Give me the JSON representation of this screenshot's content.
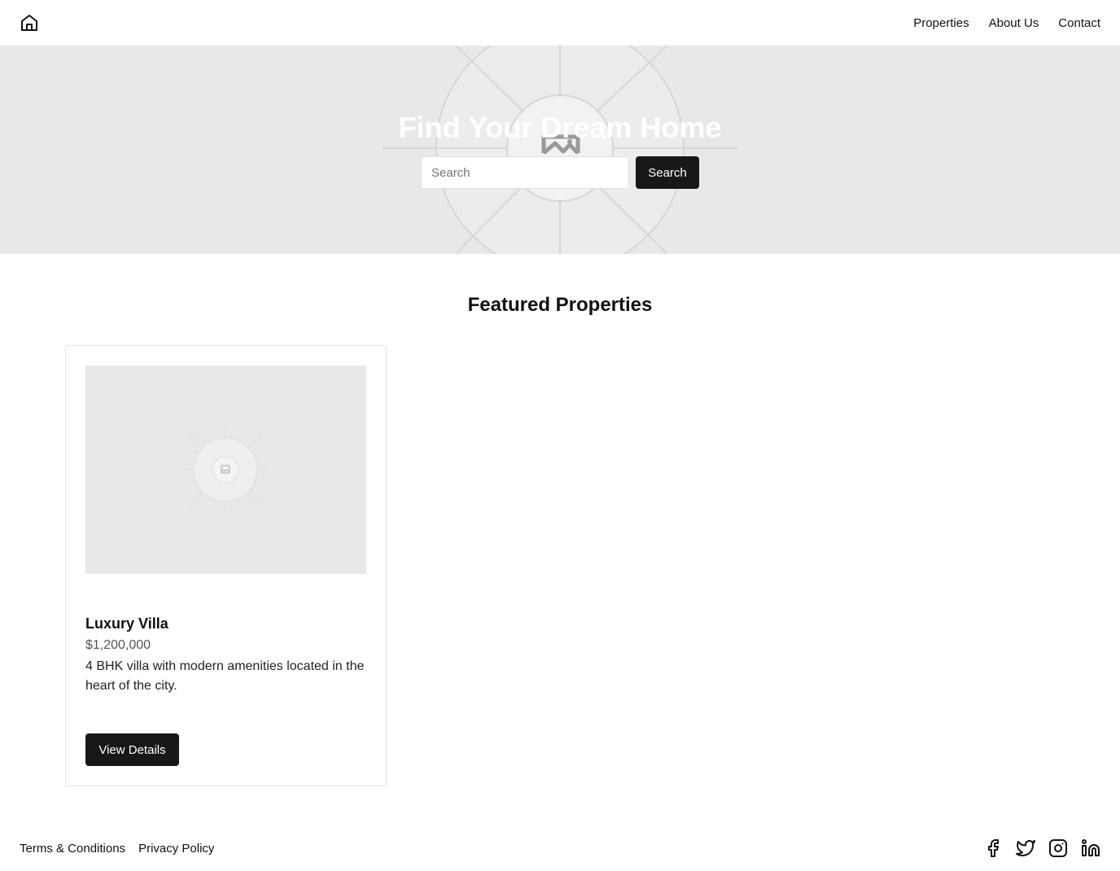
{
  "header": {
    "logo_icon": "home-icon",
    "nav": [
      {
        "label": "Properties"
      },
      {
        "label": "About Us"
      },
      {
        "label": "Contact"
      }
    ]
  },
  "hero": {
    "title": "Find Your Dream Home",
    "background_icon": "image-placeholder-icon",
    "search": {
      "placeholder": "Search",
      "value": "",
      "button_label": "Search"
    }
  },
  "featured": {
    "title": "Featured Properties",
    "cards": [
      {
        "image_icon": "image-placeholder-icon",
        "title": "Luxury Villa",
        "price": "$1,200,000",
        "description": "4 BHK villa with modern amenities located in the heart of the city.",
        "button_label": "View Details"
      }
    ]
  },
  "footer": {
    "links": [
      {
        "label": "Terms & Conditions"
      },
      {
        "label": "Privacy Policy"
      }
    ],
    "socials": [
      "facebook-icon",
      "twitter-icon",
      "instagram-icon",
      "linkedin-icon"
    ]
  },
  "colors": {
    "primary_button": "#18181b",
    "hero_background": "#e8e8e8",
    "text": "#111111"
  }
}
